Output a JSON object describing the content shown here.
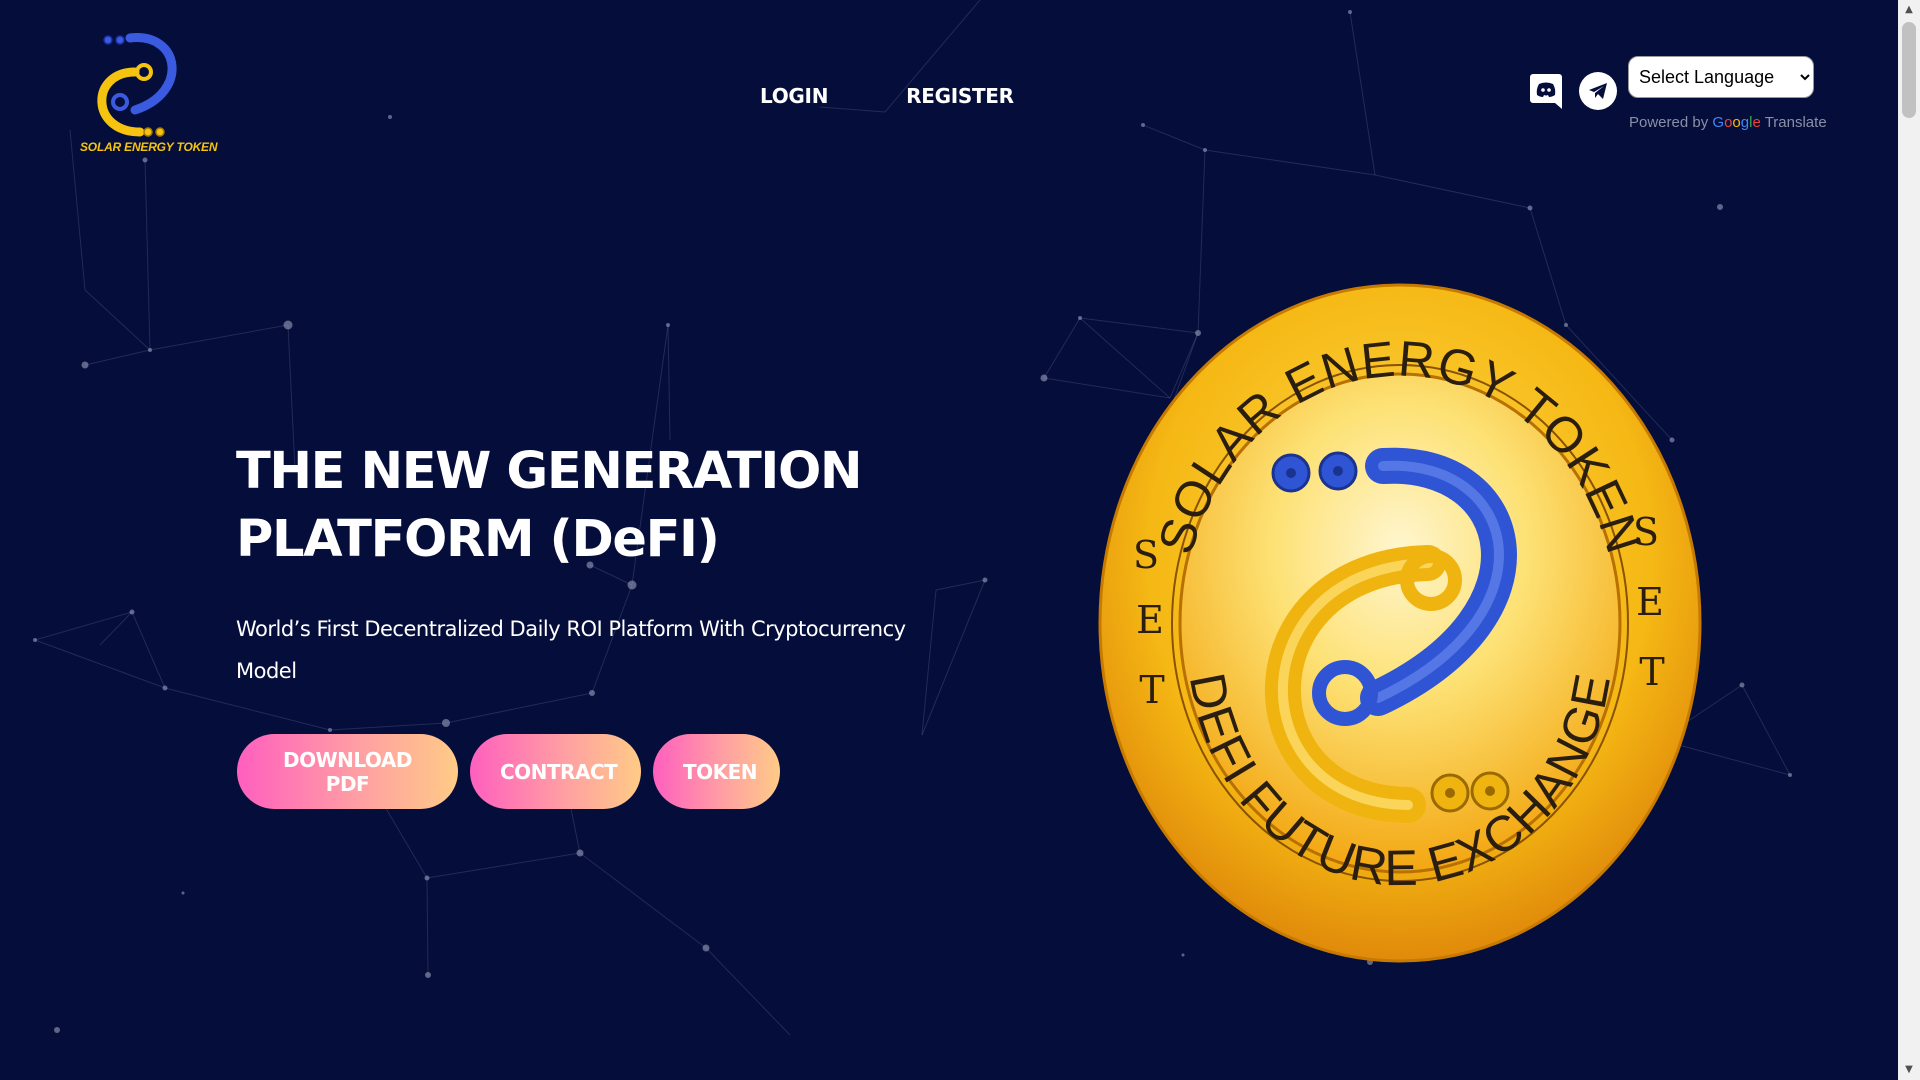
{
  "header": {
    "logo_text": "SOLAR ENERGY TOKEN",
    "nav": {
      "login": "LOGIN",
      "register": "REGISTER"
    },
    "social": [
      {
        "icon": "discord-icon"
      },
      {
        "icon": "telegram-icon"
      }
    ],
    "language": {
      "selected": "Select Language",
      "powered_by": "Powered by",
      "google": [
        "G",
        "o",
        "o",
        "g",
        "l",
        "e"
      ],
      "translate": "Translate"
    }
  },
  "hero": {
    "title_line1": "THE NEW GENERATION",
    "title_line2": "PLATFORM (DeFI)",
    "subtitle": "World’s First Decentralized Daily ROI Platform With Cryptocurrency Model",
    "buttons": {
      "download": "DOWNLOAD PDF",
      "contract": "CONTRACT",
      "token": "TOKEN"
    }
  },
  "coin": {
    "top_text": "SOLAR ENERGY TOKEN",
    "bottom_text": "DEFI FUTURE EXCHANGE",
    "side_letters_left": [
      "S",
      "E",
      "T"
    ],
    "side_letters_right": [
      "S",
      "E",
      "T"
    ]
  },
  "colors": {
    "background": "#050d3a",
    "button_gradient_start": "#ff5fbe",
    "button_gradient_end": "#ffcb86",
    "coin_gold": "#f5b814",
    "logo_blue": "#3a5be0"
  }
}
